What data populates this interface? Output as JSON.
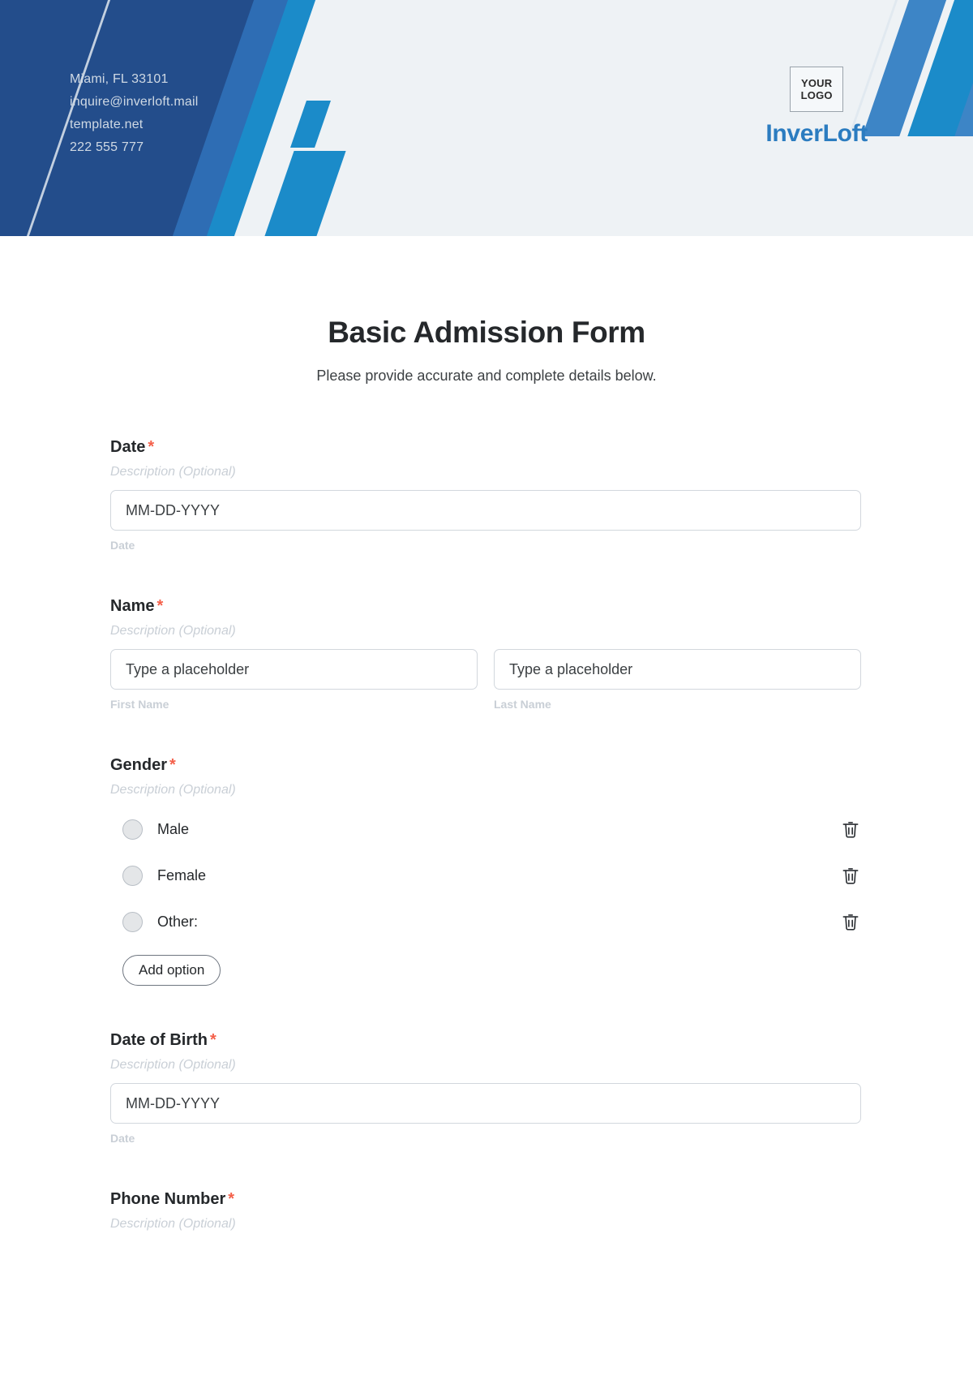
{
  "header": {
    "contact": [
      "Miami, FL 33101",
      "inquire@inverloft.mail",
      "template.net",
      "222 555 777"
    ],
    "logo_line1": "YOUR",
    "logo_line2": "LOGO",
    "brand_name": "InverLoft",
    "colors": {
      "navy": "#234d8b",
      "blue": "#3d85c6",
      "cyan": "#1b8bc9",
      "background": "#eef2f5",
      "brand_text": "#2b7cc0"
    }
  },
  "form": {
    "title": "Basic Admission Form",
    "subtitle": "Please provide accurate and complete details below.",
    "required_mark": "*",
    "description_placeholder": "Description (Optional)",
    "fields": [
      {
        "label": "Date",
        "description": "Description (Optional)",
        "value": "MM-DD-YYYY",
        "helper": "Date"
      },
      {
        "label": "Name",
        "description": "Description (Optional)",
        "first_value": "Type a placeholder",
        "first_helper": "First Name",
        "last_value": "Type a placeholder",
        "last_helper": "Last Name"
      },
      {
        "label": "Gender",
        "description": "Description (Optional)",
        "options": [
          "Male",
          "Female",
          "Other:"
        ],
        "add_option_label": "Add option"
      },
      {
        "label": "Date of Birth",
        "description": "Description (Optional)",
        "value": "MM-DD-YYYY",
        "helper": "Date"
      },
      {
        "label": "Phone Number",
        "description": "Description (Optional)"
      }
    ]
  }
}
